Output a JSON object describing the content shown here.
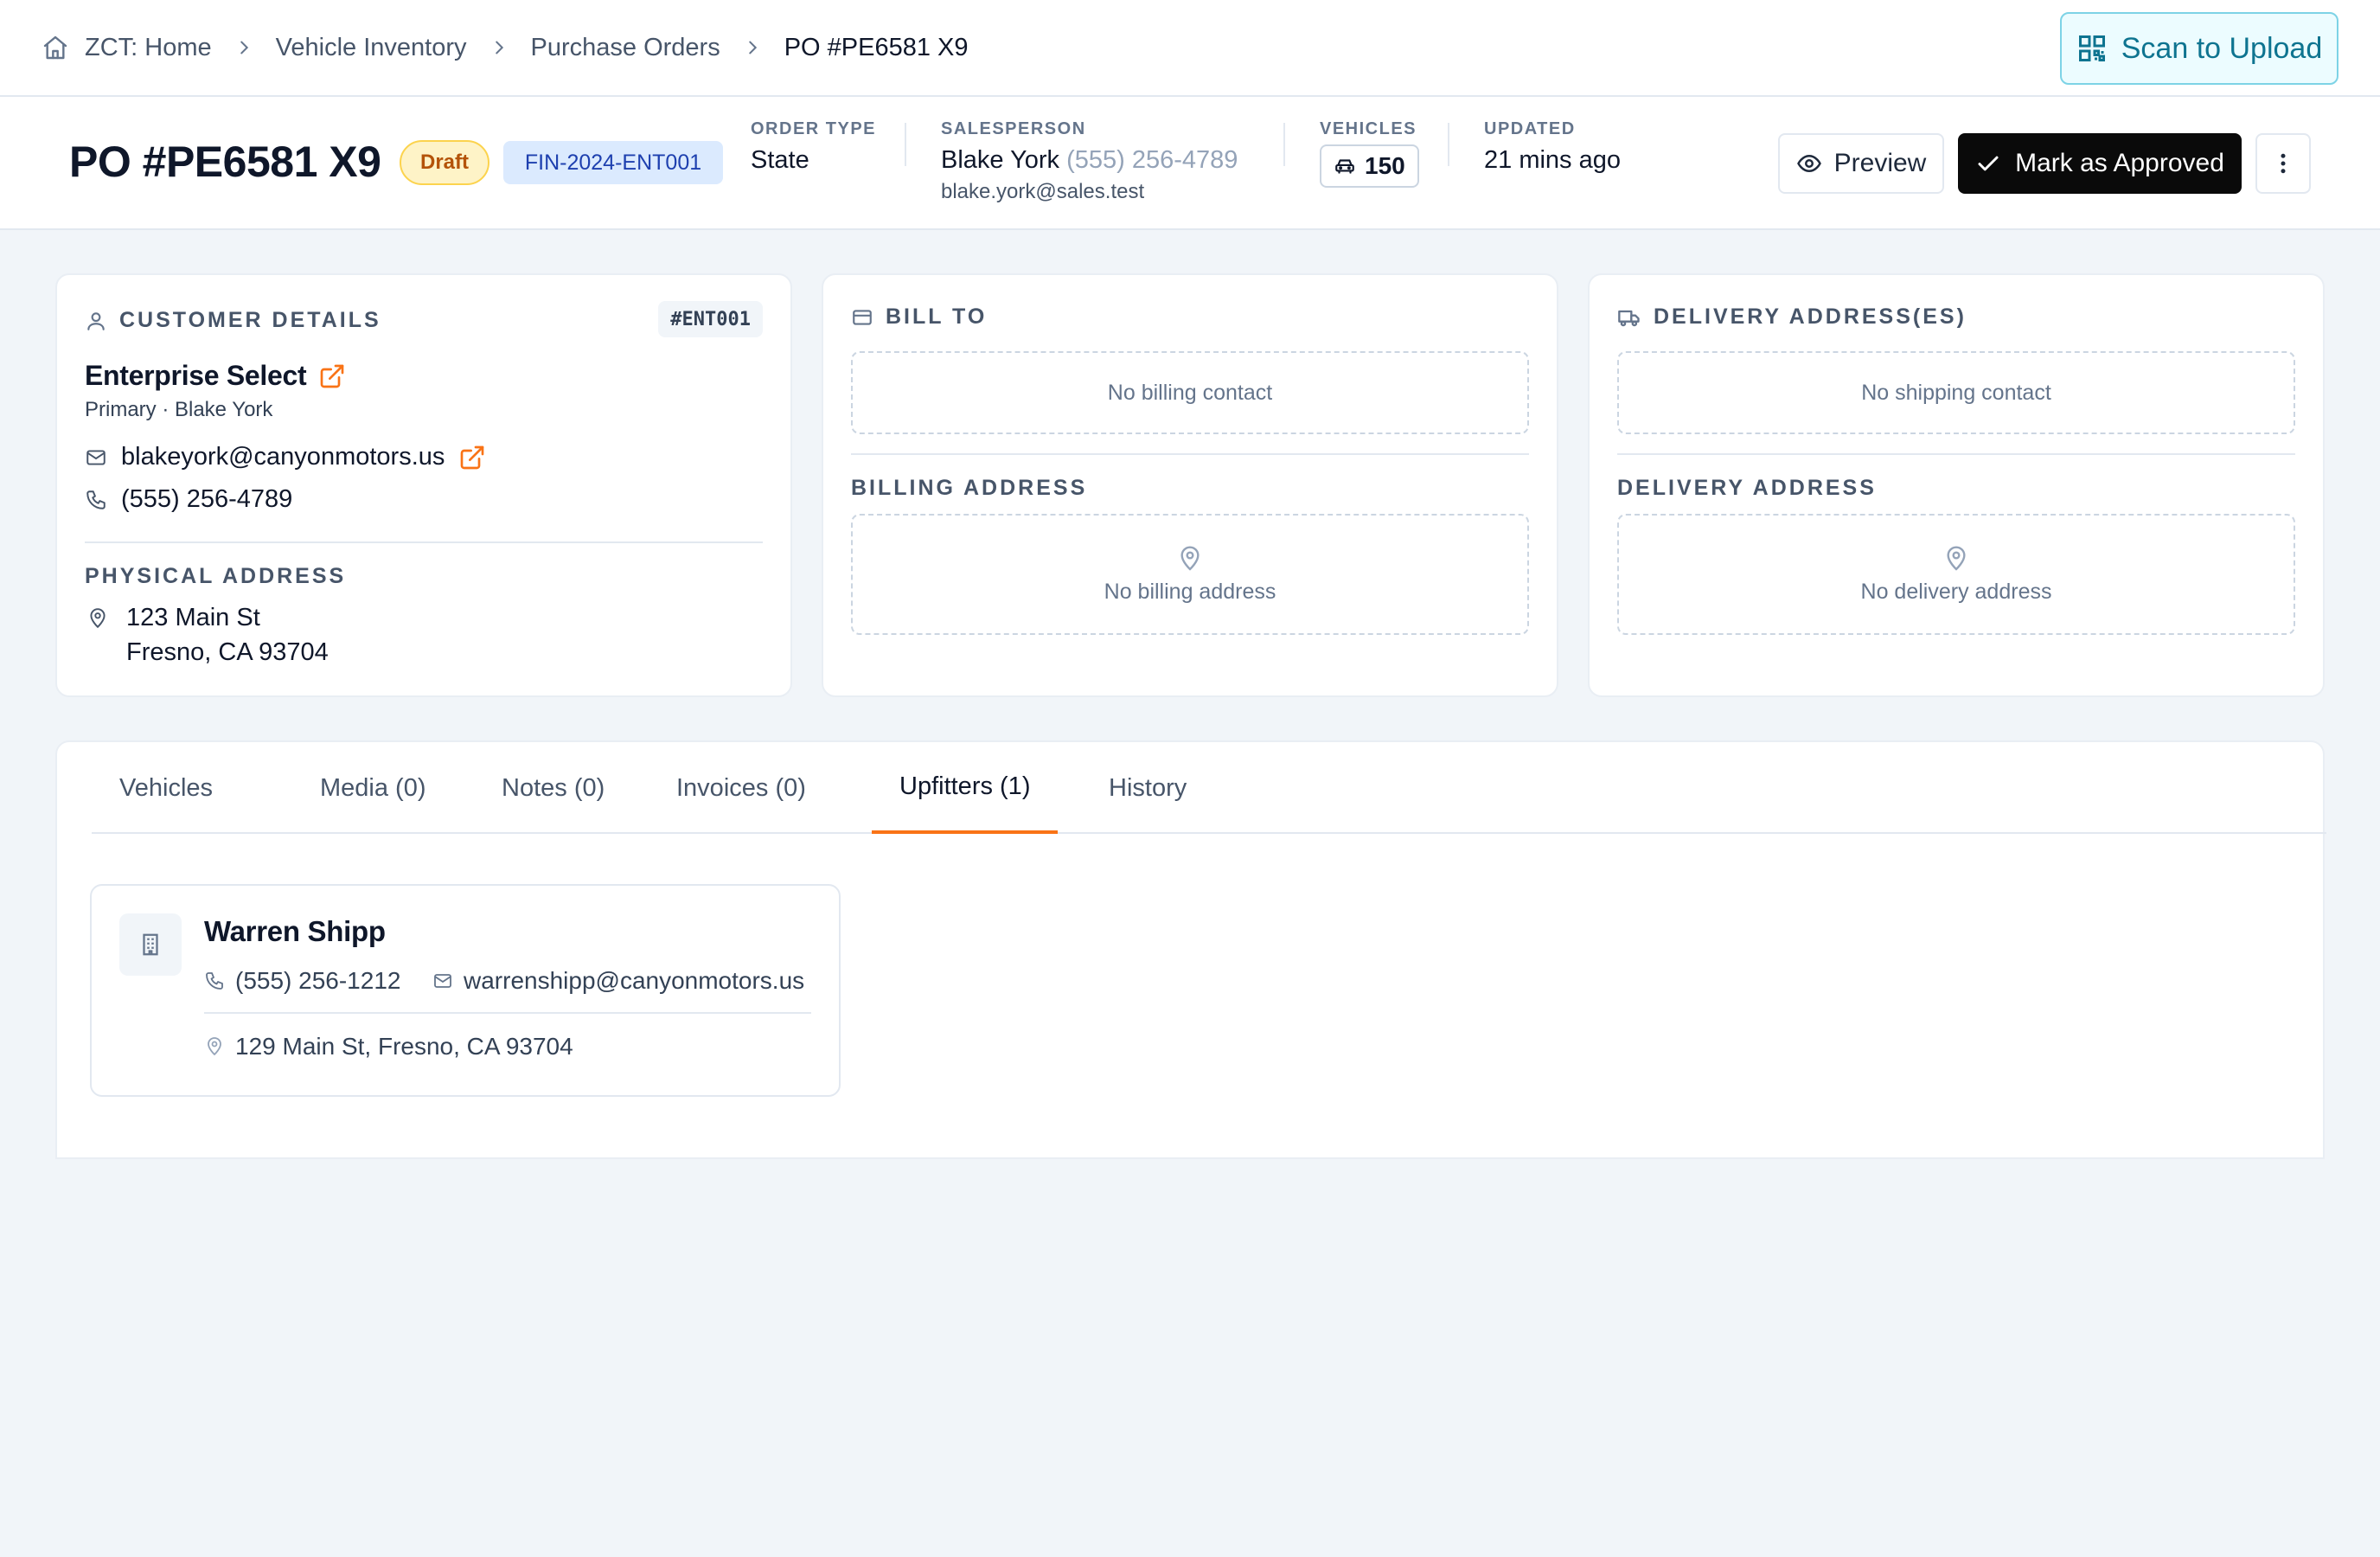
{
  "breadcrumb": {
    "home": "ZCT: Home",
    "items": [
      "Vehicle Inventory",
      "Purchase Orders"
    ],
    "current": "PO #PE6581 X9"
  },
  "scan_button": {
    "label": "Scan to Upload",
    "icon": "qr-code-icon"
  },
  "header": {
    "title": "PO #PE6581 X9",
    "status_badge": "Draft",
    "ref_badge": "FIN-2024-ENT001",
    "order_type": {
      "label": "ORDER TYPE",
      "value": "State"
    },
    "salesperson": {
      "label": "SALESPERSON",
      "name": "Blake York",
      "phone": "(555) 256-4789",
      "email": "blake.york@sales.test"
    },
    "vehicles": {
      "label": "VEHICLES",
      "count": "150"
    },
    "updated": {
      "label": "UPDATED",
      "value": "21 mins ago"
    },
    "actions": {
      "preview": "Preview",
      "approve": "Mark as Approved"
    }
  },
  "customer": {
    "title": "CUSTOMER DETAILS",
    "badge": "#ENT001",
    "name": "Enterprise Select",
    "subtitle": "Primary · Blake York",
    "email": "blakeyork@canyonmotors.us",
    "phone": "(555) 256-4789",
    "address_title": "PHYSICAL ADDRESS",
    "address_line1": "123 Main St",
    "address_line2": "Fresno, CA 93704"
  },
  "bill_to": {
    "title": "BILL TO",
    "contact_empty": "No billing contact",
    "address_title": "BILLING ADDRESS",
    "address_empty": "No billing address"
  },
  "delivery": {
    "title": "DELIVERY ADDRESS(ES)",
    "contact_empty": "No shipping contact",
    "address_title": "DELIVERY ADDRESS",
    "address_empty": "No delivery address"
  },
  "tabs": [
    {
      "label": "Vehicles"
    },
    {
      "label": "Media (0)"
    },
    {
      "label": "Notes (0)"
    },
    {
      "label": "Invoices (0)"
    },
    {
      "label": "Upfitters (1)",
      "active": true
    },
    {
      "label": "History"
    }
  ],
  "upfitter": {
    "name": "Warren Shipp",
    "phone": "(555) 256-1212",
    "email": "warrenshipp@canyonmotors.us",
    "address": "129 Main St, Fresno, CA 93704"
  },
  "colors": {
    "accent": "#f97316",
    "primary_button": "#0a0a0a",
    "scan_button": "#0e7490",
    "draft_badge": "#fef3c7",
    "ref_badge": "#dbeafe"
  }
}
